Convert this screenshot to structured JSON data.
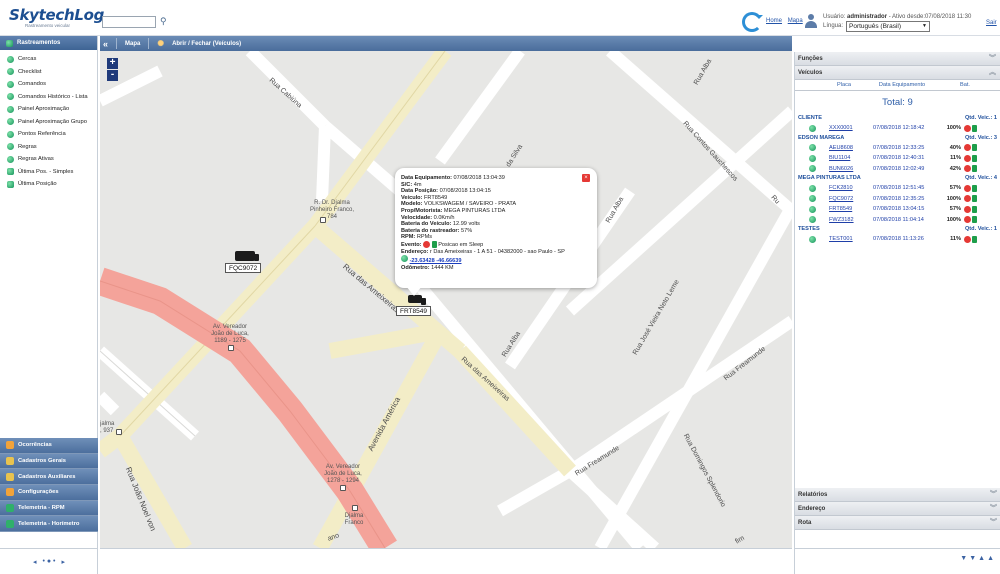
{
  "app": {
    "logo": "SkytechLog",
    "logo_sub": "Rastreamento veicular",
    "links": [
      "Home",
      "Mapa"
    ],
    "user_label": "Usuário:",
    "user_name": "administrador",
    "user_status": "- Ativo desde:07/08/2018 11:30",
    "lang_label": "Língua:",
    "lang_value": "Português (Brasil)",
    "logout": "Sair"
  },
  "sidebar": {
    "head": "Rastreamentos",
    "items": [
      "Cercas",
      "Checklist",
      "Comandos",
      "Comandos Histórico - Lista",
      "Painel Aproximação",
      "Painel Aproximação Grupo",
      "Pontos Referência",
      "Regras",
      "Regras Ativas",
      "Última Pos. - Simples",
      "Última Posição"
    ],
    "bottom": [
      {
        "label": "Ocorrências",
        "color": "#f2a33a"
      },
      {
        "label": "Cadastros Gerais",
        "color": "#e8c34f"
      },
      {
        "label": "Cadastros Auxiliares",
        "color": "#e8c34f"
      },
      {
        "label": "Configurações",
        "color": "#f2a33a"
      },
      {
        "label": "Telemetria - RPM",
        "color": "#2fb06a"
      },
      {
        "label": "Telemetria - Horímetro",
        "color": "#2fb06a"
      }
    ],
    "pager": "• ● •"
  },
  "toolbar": {
    "mapa": "Mapa",
    "toggle_vehicles": "Abrir / Fechar (Veículos)"
  },
  "map": {
    "zoom_in": "+",
    "zoom_out": "-",
    "roads": [
      {
        "text": "Rua Cabiúna"
      },
      {
        "text": "Rua Alba"
      },
      {
        "text": "Rua Contos Gauchescos"
      },
      {
        "text": "Rua Alba"
      },
      {
        "text": "Rua das Ameixeiras"
      },
      {
        "text": "Rua das Ameixeiras"
      },
      {
        "text": "Rua Alba"
      },
      {
        "text": "Rua José Vieira Neto Leme"
      },
      {
        "text": "Rua Freamunde"
      },
      {
        "text": "Rua Freamunde"
      },
      {
        "text": "Avenida América"
      },
      {
        "text": "Rua Domingos Splendorio"
      },
      {
        "text": "Rua João Noel von"
      },
      {
        "text": "da Silva"
      },
      {
        "text": "Ru"
      },
      {
        "text": "ano"
      },
      {
        "text": "fim"
      }
    ],
    "pois": [
      {
        "text": "R. Dr. Djalma\nPinheiro Franco, 784"
      },
      {
        "text": "Av. Vereador\nJoão de Luca,\n1189 - 1275"
      },
      {
        "text": "Av. Vereador\nJoão de Luca,\n1278 - 1294"
      },
      {
        "text": "Djalma\nFranco"
      },
      {
        "text": "jalma\n, 937"
      }
    ],
    "vehicles": [
      {
        "plate": "FQC9072"
      },
      {
        "plate": "FRT8549"
      }
    ]
  },
  "popup": {
    "lines": [
      {
        "k": "Data Equipamento:",
        "v": "07/08/2018 13:04:39"
      },
      {
        "k": "S/C:",
        "v": "4m"
      },
      {
        "k": "Data Posição:",
        "v": "07/08/2018 13:04:15"
      },
      {
        "k": "Veículo:",
        "v": "FRT8549"
      },
      {
        "k": "Modelo:",
        "v": "VOLKSWAGEM / SAVEIRO - PRATA"
      },
      {
        "k": "Prop/Motorista:",
        "v": "MEGA PINTURAS LTDA"
      },
      {
        "k": "Velocidade:",
        "v": "0.0Km/h"
      },
      {
        "k": "Bateria do Veículo:",
        "v": "12.99 volts"
      },
      {
        "k": "Bateria do rastreador:",
        "v": "57%"
      },
      {
        "k": "RPM:",
        "v": "RPMs"
      }
    ],
    "evento_k": "Evento:",
    "evento_v": "Posicao em Sleep",
    "endereco_k": "Endereço:",
    "endereco_v": "r Das Ameixeiras - 1 A 51 - 04382000 - sao Paulo - SP",
    "coords": "-23.63428 -46.66639",
    "odometro_k": "Odômetro:",
    "odometro_v": "1444 KM"
  },
  "right": {
    "funcoes": "Funções",
    "veiculos": "Veículos",
    "cols": [
      "Placa",
      "Data Equipamento",
      "Bat."
    ],
    "total": "Total: 9",
    "qtd_label": "Qtd. Veic.:",
    "groups": [
      {
        "name": "CLIENTE",
        "count": "1",
        "rows": [
          {
            "plate": "XXX0001",
            "date": "07/08/2018 12:18:42",
            "bat": "100%"
          }
        ]
      },
      {
        "name": "EDSON MAREGA",
        "count": "3",
        "rows": [
          {
            "plate": "AEU8608",
            "date": "07/08/2018 12:33:25",
            "bat": "40%"
          },
          {
            "plate": "BIU1104",
            "date": "07/08/2018 12:40:31",
            "bat": "11%"
          },
          {
            "plate": "BUN6026",
            "date": "07/08/2018 12:02:49",
            "bat": "42%"
          }
        ]
      },
      {
        "name": "MEGA PINTURAS LTDA",
        "count": "4",
        "rows": [
          {
            "plate": "FCK2810",
            "date": "07/08/2018 12:51:45",
            "bat": "57%"
          },
          {
            "plate": "FQC9072",
            "date": "07/08/2018 12:35:25",
            "bat": "100%"
          },
          {
            "plate": "FRT8549",
            "date": "07/08/2018 13:04:15",
            "bat": "57%"
          },
          {
            "plate": "FWZ3182",
            "date": "07/08/2018 11:04:14",
            "bat": "100%"
          }
        ]
      },
      {
        "name": "TESTES",
        "count": "1",
        "rows": [
          {
            "plate": "TEST001",
            "date": "07/08/2018 11:13:26",
            "bat": "11%"
          }
        ]
      }
    ],
    "bottom_sections": [
      "Relatórios",
      "Endereço",
      "Rota"
    ]
  }
}
